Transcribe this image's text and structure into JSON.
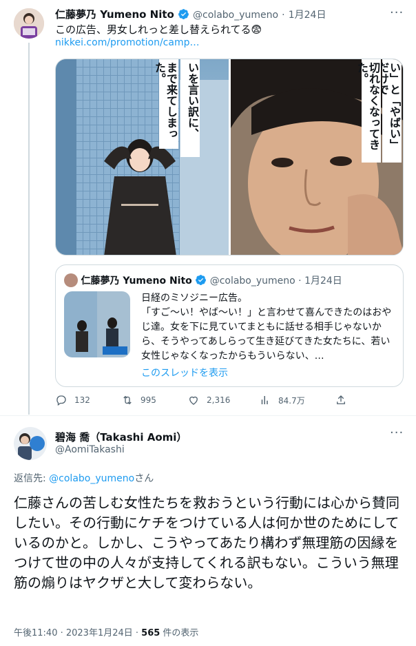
{
  "tweet1": {
    "author_name": "仁藤夢乃 Yumeno Nito",
    "handle": "@colabo_yumeno",
    "separator": "·",
    "date": "1月24日",
    "more": "···",
    "text": "この広告、男女しれっと差し替えられてる😨",
    "link": "nikkei.com/promotion/camp…",
    "media_left_caption": "いを言い訳に、\nまで来てしまった。",
    "media_right_caption": "い」と「やばい」だけで\n切れなくなってきた。",
    "quote": {
      "author_name": "仁藤夢乃 Yumeno Nito",
      "handle": "@colabo_yumeno",
      "separator": "·",
      "date": "1月24日",
      "text": "日経のミソジニー広告。\n「すご〜い！やば〜い！」と言わせて喜んできたのはおやじ達。女を下に見ていてまともに話せる相手じゃないから、そうやってあしらって生き延びてきた女たちに、若い女性じゃなくなったからもういらない、…",
      "show_thread": "このスレッドを表示"
    },
    "actions": {
      "replies": "132",
      "retweets": "995",
      "likes": "2,316",
      "views": "84.7万"
    }
  },
  "tweet2": {
    "author_name": "碧海 喬（Takashi Aomi）",
    "handle": "@AomiTakashi",
    "more": "···",
    "reply_prefix": "返信先: ",
    "reply_handle": "@colabo_yumeno",
    "reply_suffix": "さん",
    "text": "仁藤さんの苦しむ女性たちを救おうという行動には心から賛同したい。その行動にケチをつけている人は何か世のためにしているのかと。しかし、こうやってあたり構わず無理筋の因縁をつけて世の中の人々が支持してくれる訳もない。こういう無理筋の煽りはヤクザと大して変わらない。",
    "time": "午後11:40 · 2023年1月24日 · ",
    "views_count": "565",
    "views_label": " 件の表示"
  },
  "colors": {
    "accent": "#1d9bf0",
    "secondary_text": "#536471",
    "border": "#cfd9de"
  }
}
